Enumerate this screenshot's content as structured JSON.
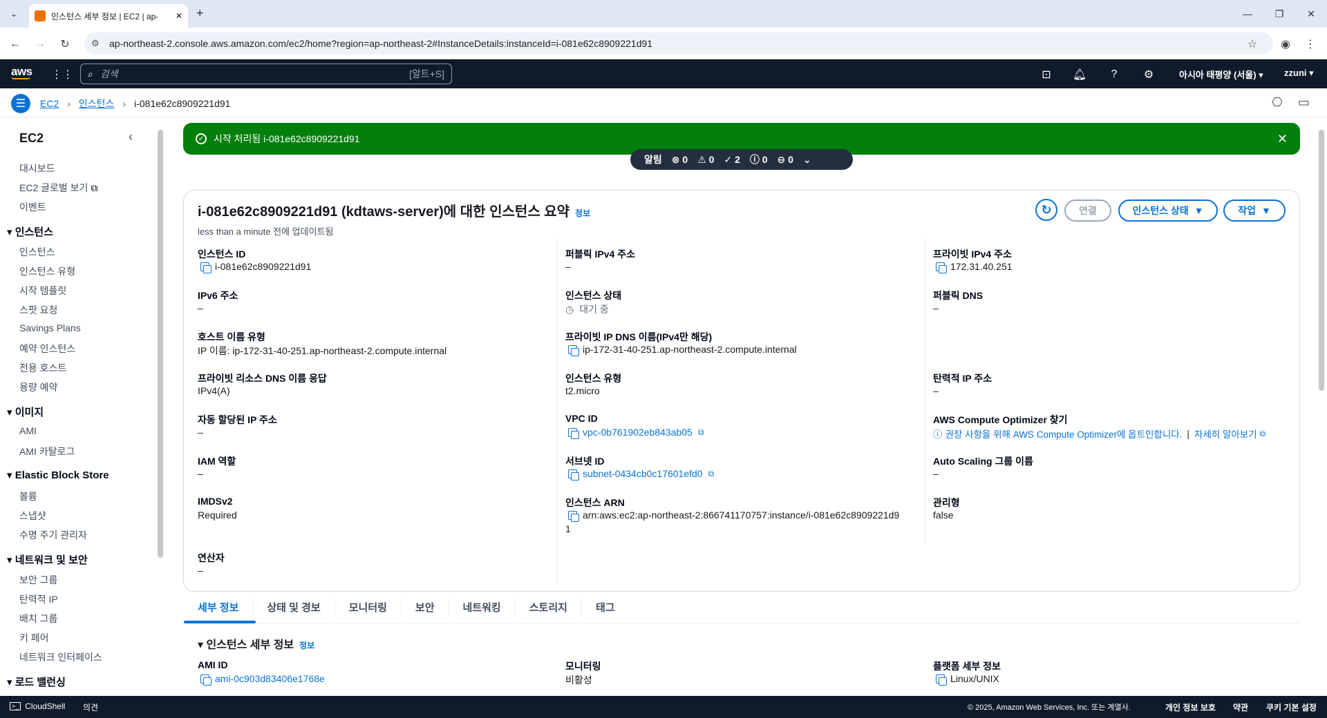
{
  "browser": {
    "tab_title": "인스턴스 세부 정보 | EC2 | ap-",
    "url": "ap-northeast-2.console.aws.amazon.com/ec2/home?region=ap-northeast-2#InstanceDetails:instanceId=i-081e62c8909221d91"
  },
  "topnav": {
    "logo": "aws",
    "search_placeholder": "검색",
    "search_shortcut": "[알트+S]",
    "region": "아시아 태평양 (서울)",
    "user": "zzuni"
  },
  "breadcrumb": [
    "EC2",
    "인스턴스",
    "i-081e62c8909221d91"
  ],
  "sidebar": {
    "title": "EC2",
    "top_items": [
      "대시보드",
      "EC2 글로벌 보기",
      "이벤트"
    ],
    "sections": [
      {
        "label": "인스턴스",
        "items": [
          "인스턴스",
          "인스턴스 유형",
          "시작 템플릿",
          "스팟 요청",
          "Savings Plans",
          "예약 인스턴스",
          "전용 호스트",
          "용량 예약"
        ]
      },
      {
        "label": "이미지",
        "items": [
          "AMI",
          "AMI 카탈로그"
        ]
      },
      {
        "label": "Elastic Block Store",
        "items": [
          "볼륨",
          "스냅샷",
          "수명 주기 관리자"
        ]
      },
      {
        "label": "네트워크 및 보안",
        "items": [
          "보안 그룹",
          "탄력적 IP",
          "배치 그룹",
          "키 페어",
          "네트워크 인터페이스"
        ]
      },
      {
        "label": "로드 밸런싱",
        "items": []
      }
    ]
  },
  "flash": {
    "message": "시작 처리됨 i-081e62c8909221d91"
  },
  "notifications": {
    "label": "알림",
    "error": "0",
    "warning": "0",
    "success": "2",
    "info": "0",
    "in_progress": "0"
  },
  "summary": {
    "title": "i-081e62c8909221d91 (kdtaws-server)에 대한 인스턴스 요약",
    "info": "정보",
    "updated": "less than a minute 전에 업데이트됨",
    "buttons": {
      "connect": "연결",
      "state": "인스턴스 상태",
      "actions": "작업"
    },
    "col1": [
      {
        "label": "인스턴스 ID",
        "value": "i-081e62c8909221d91"
      },
      {
        "label": "IPv6 주소",
        "value": "–"
      },
      {
        "label": "호스트 이름 유형",
        "value": "IP 이름: ip-172-31-40-251.ap-northeast-2.compute.internal"
      },
      {
        "label": "프라이빗 리소스 DNS 이름 응답",
        "value": "IPv4(A)"
      },
      {
        "label": "자동 할당된 IP 주소",
        "value": "–"
      },
      {
        "label": "IAM 역할",
        "value": "–"
      },
      {
        "label": "IMDSv2",
        "value": "Required"
      },
      {
        "label": "연산자",
        "value": "–"
      }
    ],
    "col2": [
      {
        "label": "퍼블릭 IPv4 주소",
        "value": "–"
      },
      {
        "label": "인스턴스 상태",
        "value": "대기 중"
      },
      {
        "label": "프라이빗 IP DNS 이름(IPv4만 해당)",
        "value": "ip-172-31-40-251.ap-northeast-2.compute.internal"
      },
      {
        "label": "인스턴스 유형",
        "value": "t2.micro"
      },
      {
        "label": "VPC ID",
        "value": "vpc-0b761902eb843ab05"
      },
      {
        "label": "서브넷 ID",
        "value": "subnet-0434cb0c17601efd0"
      },
      {
        "label": "인스턴스 ARN",
        "value": "arn:aws:ec2:ap-northeast-2:866741170757:instance/i-081e62c8909221d9",
        "value2": "1"
      }
    ],
    "col3": [
      {
        "label": "프라이빗 IPv4 주소",
        "value": "172.31.40.251"
      },
      {
        "label": "퍼블릭 DNS",
        "value": "–"
      },
      {
        "label": "탄력적 IP 주소",
        "value": "–"
      },
      {
        "label": "AWS Compute Optimizer 찾기",
        "value": "권장 사항을 위해 AWS Compute Optimizer에 옵트인합니다.",
        "value_sep": "|",
        "value_link": "자세히 알아보기"
      },
      {
        "label": "Auto Scaling 그룹 이름",
        "value": "–"
      },
      {
        "label": "관리형",
        "value": "false"
      }
    ]
  },
  "tabs": [
    "세부 정보",
    "상태 및 경보",
    "모니터링",
    "보안",
    "네트워킹",
    "스토리지",
    "태그"
  ],
  "details": {
    "title": "인스턴스 세부 정보",
    "info": "정보",
    "fields": [
      {
        "label": "AMI ID",
        "value": "ami-0c903d83406e1768e"
      },
      {
        "label": "모니터링",
        "value": "비활성"
      },
      {
        "label": "플랫폼 세부 정보",
        "value": "Linux/UNIX"
      }
    ]
  },
  "footer": {
    "cloudshell": "CloudShell",
    "feedback": "의견",
    "copyright": "© 2025, Amazon Web Services, Inc. 또는 계열사.",
    "privacy": "개인 정보 보호",
    "terms": "약관",
    "cookies": "쿠키 기본 설정"
  },
  "colors": {
    "primary": "#0972d3",
    "success": "#037f0c",
    "nav": "#0f1b2a"
  }
}
